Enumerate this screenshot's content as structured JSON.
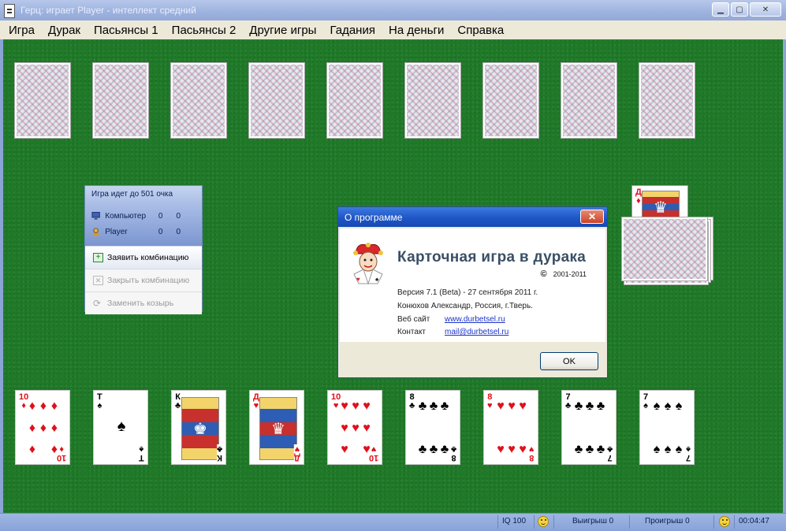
{
  "window": {
    "title": "Герц: играет Player - интеллект средний"
  },
  "menu": [
    "Игра",
    "Дурак",
    "Пасьянсы 1",
    "Пасьянсы 2",
    "Другие игры",
    "Гадания",
    "На деньги",
    "Справка"
  ],
  "score_panel": {
    "header": "Игра идет до 501 очка",
    "players": [
      {
        "name": "Компьютер",
        "score1": "0",
        "score2": "0"
      },
      {
        "name": "Player",
        "score1": "0",
        "score2": "0"
      }
    ],
    "buttons": [
      "Заявить комбинацию",
      "Закрыть комбинацию",
      "Заменить козырь"
    ]
  },
  "hand": [
    {
      "rank": "10",
      "suit": "♦",
      "color": "red"
    },
    {
      "rank": "Т",
      "suit": "♠",
      "color": "black"
    },
    {
      "rank": "К",
      "suit": "♣",
      "color": "black"
    },
    {
      "rank": "Д",
      "suit": "♥",
      "color": "red"
    },
    {
      "rank": "10",
      "suit": "♥",
      "color": "red"
    },
    {
      "rank": "8",
      "suit": "♣",
      "color": "black"
    },
    {
      "rank": "8",
      "suit": "♥",
      "color": "red"
    },
    {
      "rank": "7",
      "suit": "♣",
      "color": "black"
    },
    {
      "rank": "7",
      "suit": "♠",
      "color": "black"
    }
  ],
  "trump_card": {
    "rank": "Д",
    "suit": "♦",
    "color": "red"
  },
  "dialog": {
    "title": "О программе",
    "heading": "Карточная игра в дурака",
    "copyright_symbol": "©",
    "copyright_years": "2001-2011",
    "version": "Версия 7.1 (Beta) - 27 сентября 2011 г.",
    "author": "Конюхов Александр, Россия, г.Тверь.",
    "website_label": "Веб сайт",
    "website": "www.durbetsel.ru",
    "contact_label": "Контакт",
    "contact": "mail@durbetsel.ru",
    "ok_label": "OK"
  },
  "status": {
    "iq": "IQ 100",
    "wins": "Выигрыш 0",
    "losses": "Проигрыш 0",
    "timer": "00:04:47"
  }
}
